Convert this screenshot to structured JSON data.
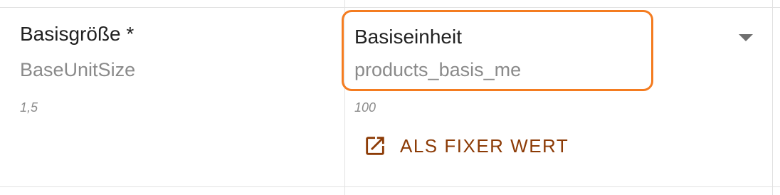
{
  "field": {
    "label": "Basisgröße *",
    "technical_name": "BaseUnitSize",
    "example": "1,5"
  },
  "mapping": {
    "selected_label": "Basiseinheit",
    "selected_technical": "products_basis_me",
    "example": "100",
    "fixed_value_button": "ALS FIXER WERT",
    "accent_color": "#f47c20",
    "button_color": "#8c3b06"
  }
}
